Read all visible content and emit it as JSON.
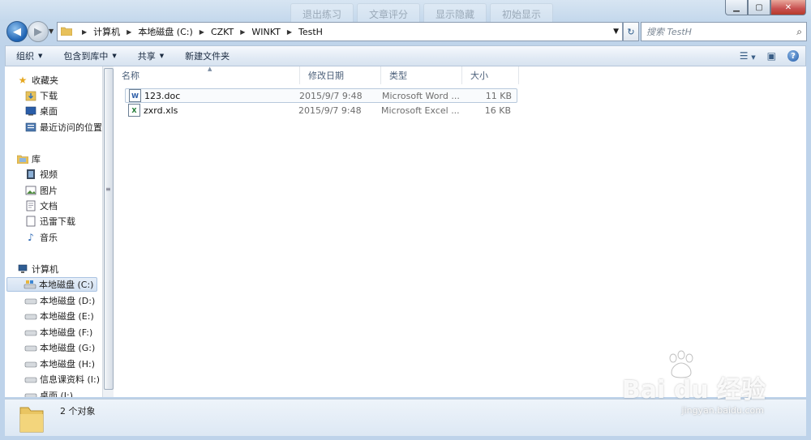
{
  "background_tabs": [
    "退出练习",
    "文章评分",
    "显示隐藏",
    "初始显示"
  ],
  "window_controls": {
    "minimize": "▁",
    "maximize": "▢",
    "close": "✕"
  },
  "address": {
    "crumbs": [
      "计算机",
      "本地磁盘 (C:)",
      "CZKT",
      "WINKT",
      "TestH"
    ]
  },
  "search": {
    "placeholder": "搜索 TestH"
  },
  "toolbar": {
    "organize": "组织",
    "include_library": "包含到库中",
    "share": "共享",
    "new_folder": "新建文件夹"
  },
  "nav": {
    "favorites": "收藏夹",
    "downloads": "下载",
    "desktop": "桌面",
    "recent": "最近访问的位置",
    "library": "库",
    "videos": "视频",
    "pictures": "图片",
    "documents": "文档",
    "thunder": "迅雷下载",
    "music": "音乐",
    "computer": "计算机",
    "drives": [
      "本地磁盘 (C:)",
      "本地磁盘 (D:)",
      "本地磁盘 (E:)",
      "本地磁盘 (F:)",
      "本地磁盘 (G:)",
      "本地磁盘 (H:)",
      "信息课资料 (I:)",
      "桌面 (J:)"
    ]
  },
  "columns": {
    "name": "名称",
    "date": "修改日期",
    "type": "类型",
    "size": "大小"
  },
  "files": [
    {
      "name": "123.doc",
      "date": "2015/9/7 9:48",
      "type": "Microsoft Word ...",
      "size": "11 KB",
      "icon": "word-doc-icon"
    },
    {
      "name": "zxrd.xls",
      "date": "2015/9/7 9:48",
      "type": "Microsoft Excel ...",
      "size": "16 KB",
      "icon": "excel-doc-icon"
    }
  ],
  "status": {
    "count": "2 个对象"
  },
  "watermark": {
    "logo": "Bai du 经验",
    "url": "jingyan.baidu.com"
  }
}
